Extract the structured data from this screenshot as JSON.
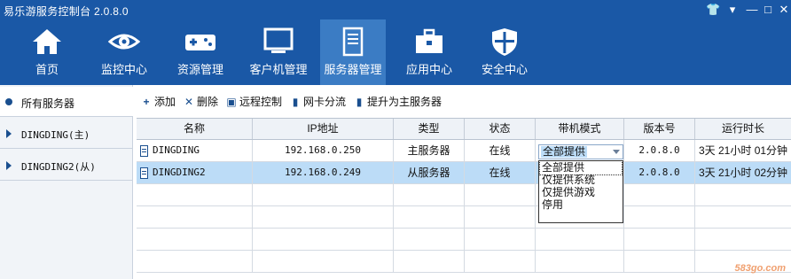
{
  "app": {
    "title": "易乐游服务控制台 2.0.8.0"
  },
  "colors": {
    "accent": "#1a58a6",
    "active_tab": "#3b7cc4",
    "selected_row": "#bcdcf7"
  },
  "window_controls": [
    {
      "name": "shirt-icon",
      "glyph": "👕"
    },
    {
      "name": "minimize-arrow-icon",
      "glyph": "▾"
    },
    {
      "name": "minimize-icon",
      "glyph": "—"
    },
    {
      "name": "maximize-icon",
      "glyph": "□"
    },
    {
      "name": "close-icon",
      "glyph": "✕"
    }
  ],
  "nav": {
    "items": [
      {
        "label": "首页",
        "icon": "home-icon"
      },
      {
        "label": "监控中心",
        "icon": "eye-icon"
      },
      {
        "label": "资源管理",
        "icon": "gamepad-icon"
      },
      {
        "label": "客户机管理",
        "icon": "monitor-icon"
      },
      {
        "label": "服务器管理",
        "icon": "server-icon",
        "active": true
      },
      {
        "label": "应用中心",
        "icon": "toolbox-icon"
      },
      {
        "label": "安全中心",
        "icon": "shield-icon"
      }
    ]
  },
  "sidebar": {
    "items": [
      {
        "label": "所有服务器",
        "active": true
      },
      {
        "label": "DINGDING(主)"
      },
      {
        "label": "DINGDING2(从)"
      }
    ]
  },
  "toolbar": {
    "add": "添加",
    "delete": "删除",
    "remote": "远程控制",
    "nic_split": "网卡分流",
    "promote": "提升为主服务器"
  },
  "table": {
    "columns": [
      "名称",
      "IP地址",
      "类型",
      "状态",
      "带机模式",
      "版本号",
      "运行时长"
    ],
    "rows": [
      {
        "name": "DINGDING",
        "ip": "192.168.0.250",
        "type": "主服务器",
        "status": "在线",
        "mode": "全部提供",
        "version": "2.0.8.0",
        "uptime": "3天 21小时 01分钟"
      },
      {
        "name": "DINGDING2",
        "ip": "192.168.0.249",
        "type": "从服务器",
        "status": "在线",
        "mode": "",
        "version": "2.0.8.0",
        "uptime": "3天 21小时 02分钟"
      }
    ]
  },
  "mode_dropdown": {
    "selected": "全部提供",
    "options": [
      "全部提供",
      "仅提供系统",
      "仅提供游戏",
      "停用"
    ]
  },
  "watermark": "583go.com"
}
